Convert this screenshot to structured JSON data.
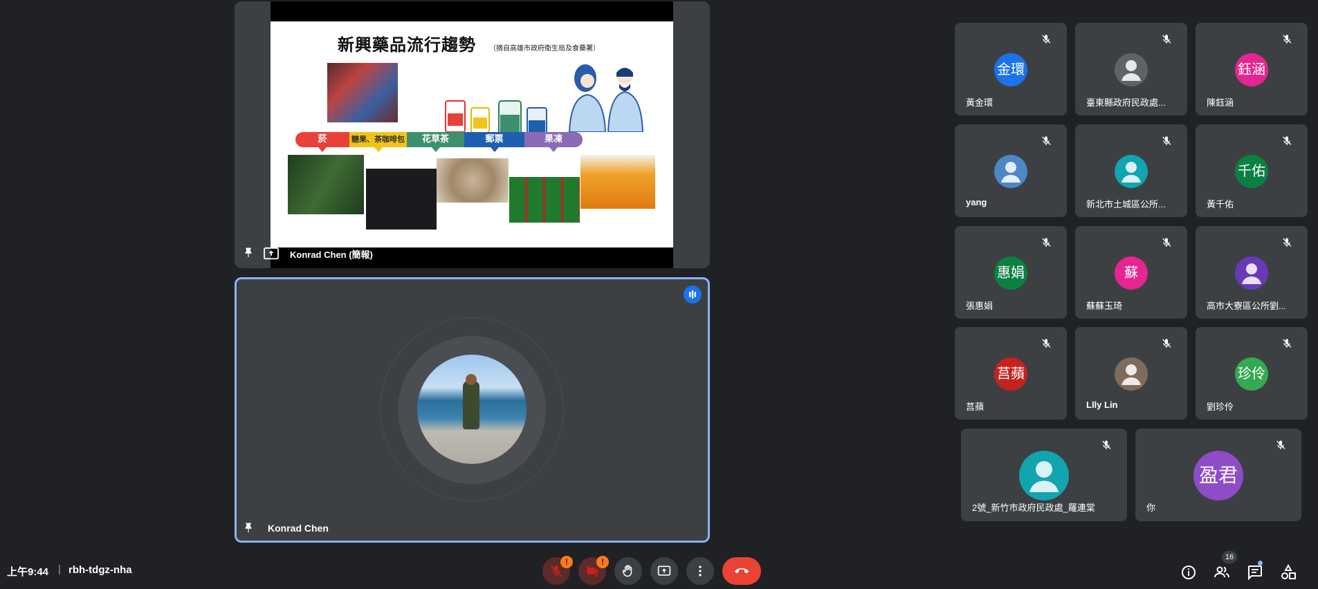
{
  "presentation": {
    "presenter_label": "Konrad Chen (簡報)",
    "slide_title": "新興藥品流行趨勢",
    "slide_subtitle": "（摘自高雄市政府衛生局及食藥署）",
    "categories": [
      "菸",
      "糖果、茶咖啡包",
      "花草茶",
      "郵票",
      "果凍"
    ],
    "category_colors": [
      "#e8413a",
      "#f2c418",
      "#3d8f6e",
      "#1f5fb0",
      "#8b6bb5"
    ]
  },
  "speaker": {
    "name": "Konrad Chen",
    "accent": "#8ab4f8"
  },
  "participants": [
    {
      "name": "黃金環",
      "initials": "金環",
      "color": "#1a73e8"
    },
    {
      "name": "臺東縣政府民政處...",
      "initials": "",
      "color": "#5f6368"
    },
    {
      "name": "陳鈺涵",
      "initials": "鈺涵",
      "color": "#e52592"
    },
    {
      "name": "yang",
      "initials": "",
      "color": "#4f86c6"
    },
    {
      "name": "新北市土城區公所...",
      "initials": "",
      "color": "#12a4af"
    },
    {
      "name": "黃千佑",
      "initials": "千佑",
      "color": "#0b8043"
    },
    {
      "name": "張惠娟",
      "initials": "惠娟",
      "color": "#0b8043"
    },
    {
      "name": "蘇蘇玉琦",
      "initials": "蘇",
      "color": "#e52592"
    },
    {
      "name": "高市大寮區公所劉...",
      "initials": "",
      "color": "#673ab7"
    },
    {
      "name": "莒蘋",
      "initials": "莒蘋",
      "color": "#c5221f"
    },
    {
      "name": "Llly Lin",
      "initials": "",
      "color": "#7d6b5e"
    },
    {
      "name": "劉珍伶",
      "initials": "珍伶",
      "color": "#34a853"
    },
    {
      "name": "2號_新竹市政府民政處_羅連棠",
      "initials": "",
      "color": "#12a4af"
    },
    {
      "name": "你",
      "initials": "盈君",
      "color": "#8e4cc7"
    }
  ],
  "bottom_bar": {
    "time": "上午9:44",
    "separator": "|",
    "meeting_code": "rbh-tdgz-nha",
    "alert_mark": "!",
    "people_count": "16"
  }
}
